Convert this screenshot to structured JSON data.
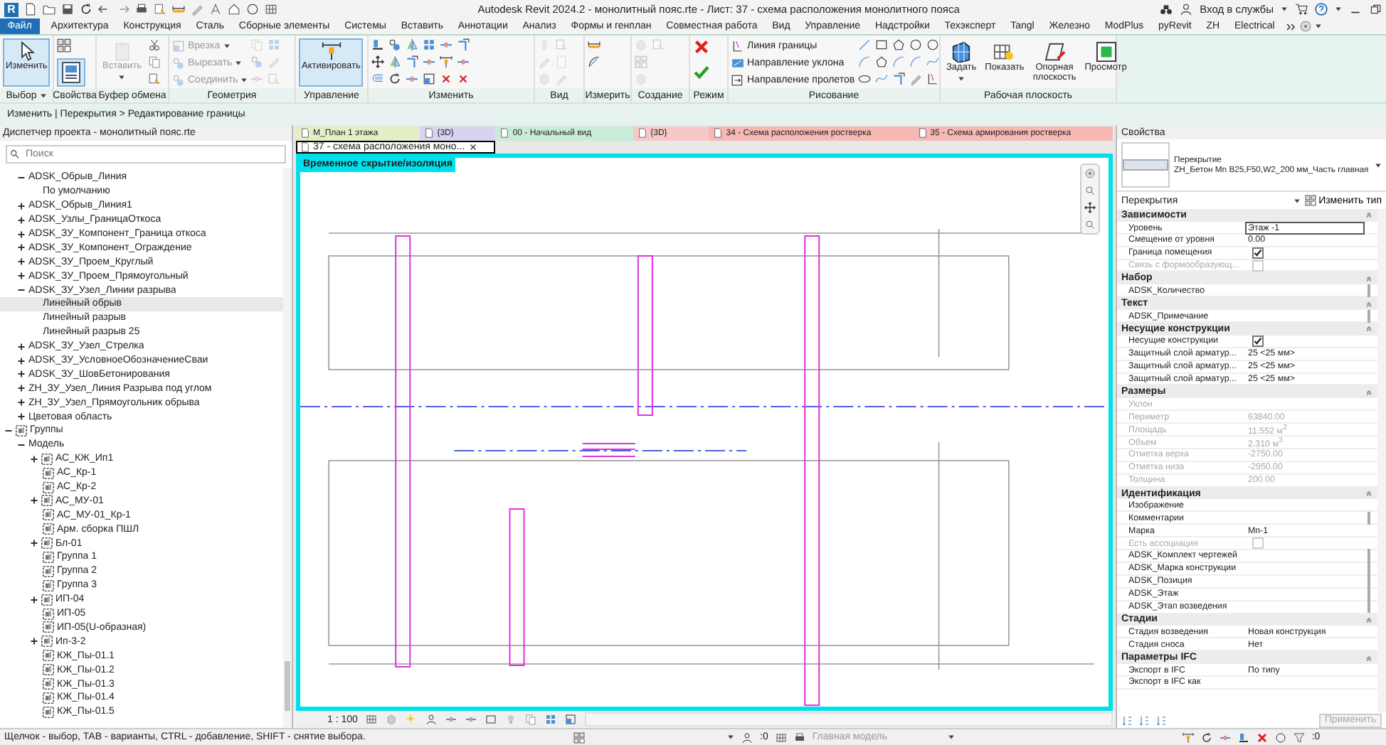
{
  "window": {
    "app_logo": "R",
    "title": "Autodesk Revit 2024.2 - монолитный пояс.rte - Лист: 37 - схема расположения монолитного пояса",
    "sign_in": "Вход в службы"
  },
  "menu_tabs": [
    {
      "label": "Файл",
      "kind": "file",
      "selected": false
    },
    {
      "label": "Архитектура",
      "kind": "tab",
      "selected": false
    },
    {
      "label": "Конструкция",
      "kind": "tab",
      "selected": false
    },
    {
      "label": "Сталь",
      "kind": "tab",
      "selected": false
    },
    {
      "label": "Сборные элементы",
      "kind": "tab",
      "selected": false
    },
    {
      "label": "Системы",
      "kind": "tab",
      "selected": false
    },
    {
      "label": "Вставить",
      "kind": "tab",
      "selected": false
    },
    {
      "label": "Аннотации",
      "kind": "tab",
      "selected": false
    },
    {
      "label": "Анализ",
      "kind": "tab",
      "selected": false
    },
    {
      "label": "Формы и генплан",
      "kind": "tab",
      "selected": false
    },
    {
      "label": "Совместная работа",
      "kind": "tab",
      "selected": false
    },
    {
      "label": "Вид",
      "kind": "tab",
      "selected": false
    },
    {
      "label": "Управление",
      "kind": "tab",
      "selected": false
    },
    {
      "label": "Надстройки",
      "kind": "tab",
      "selected": false
    },
    {
      "label": "Техэксперт",
      "kind": "tab",
      "selected": false
    },
    {
      "label": "Tangl",
      "kind": "tab",
      "selected": false
    },
    {
      "label": "Железно",
      "kind": "tab",
      "selected": false
    },
    {
      "label": "ModPlus",
      "kind": "tab",
      "selected": false
    },
    {
      "label": "pyRevit",
      "kind": "tab",
      "selected": false
    },
    {
      "label": "ZH",
      "kind": "tab",
      "selected": false
    },
    {
      "label": "Electrical",
      "kind": "tab",
      "selected": false
    }
  ],
  "ribbon": {
    "panels": [
      {
        "label": "Выбор",
        "dropdown": true,
        "tools": [
          {
            "label": "Изменить",
            "kind": "large",
            "selected": true,
            "disabled": false
          }
        ]
      },
      {
        "label": "Свойства",
        "tools": [
          {
            "kind": "icon",
            "selected": true,
            "disabled": false
          }
        ]
      },
      {
        "label": "Буфер обмена",
        "tools": [
          {
            "label": "Вставить",
            "kind": "large",
            "selected": false,
            "disabled": true,
            "dropdown": true
          }
        ]
      },
      {
        "label": "Геометрия",
        "icons_disabled": true,
        "tools": [
          {
            "label": "Врезка",
            "kind": "small",
            "selected": false,
            "disabled": true,
            "dropdown": true
          },
          {
            "label": "Вырезать",
            "kind": "small",
            "selected": false,
            "disabled": true,
            "dropdown": true
          },
          {
            "label": "Соединить",
            "kind": "small",
            "selected": false,
            "disabled": true,
            "dropdown": true
          }
        ]
      },
      {
        "label": "Управление",
        "tools": [
          {
            "label": "Активировать",
            "kind": "large",
            "selected": true,
            "disabled": false
          }
        ]
      },
      {
        "label": "Изменить"
      },
      {
        "label": "Вид",
        "icons_disabled": true
      },
      {
        "label": "Измерить"
      },
      {
        "label": "Создание",
        "icons_disabled": true
      },
      {
        "label": "Режим"
      },
      {
        "label": "Рисование",
        "tools": [
          {
            "label": "Линия границы",
            "kind": "small",
            "selected": false,
            "disabled": false
          },
          {
            "label": "Направление уклона",
            "kind": "small",
            "selected": false,
            "disabled": false
          },
          {
            "label": "Направление пролетов",
            "kind": "small",
            "selected": false,
            "disabled": false
          }
        ]
      },
      {
        "label": "Рабочая плоскость",
        "tools": [
          {
            "label": "Задать",
            "kind": "large",
            "selected": false,
            "disabled": false,
            "dropdown": true
          },
          {
            "label": "Показать",
            "kind": "large",
            "selected": false,
            "disabled": false
          },
          {
            "label": "Опорная плоскость",
            "kind": "large",
            "selected": false,
            "disabled": false
          },
          {
            "label": "Просмотр",
            "kind": "large",
            "selected": false,
            "disabled": false
          }
        ]
      }
    ]
  },
  "breadcrumb": "Изменить | Перекрытия > Редактирование границы",
  "browser": {
    "title": "Диспетчер проекта - монолитный пояс.rte",
    "search": {
      "placeholder": "Поиск"
    },
    "tree": [
      {
        "kind": "continuation",
        "children": [
          {
            "label": "ADSK_Обрыв_Линия",
            "expanded": true,
            "selected": false,
            "children": [
              {
                "label": "По умолчанию",
                "selected": false
              }
            ]
          },
          {
            "label": "ADSK_Обрыв_Линия1",
            "expanded": false,
            "selected": false
          },
          {
            "label": "ADSK_Узлы_ГраницаОткоса",
            "expanded": false,
            "selected": false
          },
          {
            "label": "ADSK_ЗУ_Компонент_Граница откоса",
            "expanded": false,
            "selected": false
          },
          {
            "label": "ADSK_ЗУ_Компонент_Ограждение",
            "expanded": false,
            "selected": false
          },
          {
            "label": "ADSK_ЗУ_Проем_Круглый",
            "expanded": false,
            "selected": false
          },
          {
            "label": "ADSK_ЗУ_Проем_Прямоугольный",
            "expanded": false,
            "selected": false
          },
          {
            "label": "ADSK_ЗУ_Узел_Линии разрыва",
            "expanded": true,
            "selected": false,
            "children": [
              {
                "label": "Линейный обрыв",
                "selected": true
              },
              {
                "label": "Линейный разрыв",
                "selected": false
              },
              {
                "label": "Линейный разрыв 25",
                "selected": false
              }
            ]
          },
          {
            "label": "ADSK_ЗУ_Узел_Стрелка",
            "expanded": false,
            "selected": false
          },
          {
            "label": "ADSK_ЗУ_УсловноеОбозначениеСваи",
            "expanded": false,
            "selected": false
          },
          {
            "label": "ADSK_ЗУ_ШовБетонирования",
            "expanded": false,
            "selected": false
          },
          {
            "label": "ZH_ЗУ_Узел_Линия Разрыва под углом",
            "expanded": false,
            "selected": false
          },
          {
            "label": "ZH_ЗУ_Узел_Прямоугольник обрыва",
            "expanded": false,
            "selected": false
          },
          {
            "label": "Цветовая область",
            "expanded": false,
            "selected": false
          }
        ]
      },
      {
        "label": "Группы",
        "kind": "group",
        "expanded": true,
        "selected": false,
        "children": [
          {
            "label": "Модель",
            "expanded": true,
            "selected": false,
            "children": [
              {
                "label": "АС_КЖ_Ип1",
                "kind": "group",
                "expanded": false,
                "selected": false
              },
              {
                "label": "АС_Кр-1",
                "kind": "group",
                "selected": false
              },
              {
                "label": "АС_Кр-2",
                "kind": "group",
                "selected": false
              },
              {
                "label": "АС_МУ-01",
                "kind": "group",
                "expanded": false,
                "selected": false
              },
              {
                "label": "АС_МУ-01_Кр-1",
                "kind": "group",
                "selected": false
              },
              {
                "label": "Арм. сборка ПШЛ",
                "kind": "group",
                "selected": false
              },
              {
                "label": "Бл-01",
                "kind": "group",
                "expanded": false,
                "selected": false
              },
              {
                "label": "Группа 1",
                "kind": "group",
                "selected": false
              },
              {
                "label": "Группа 2",
                "kind": "group",
                "selected": false
              },
              {
                "label": "Группа 3",
                "kind": "group",
                "selected": false
              },
              {
                "label": "ИП-04",
                "kind": "group",
                "expanded": false,
                "selected": false
              },
              {
                "label": "ИП-05",
                "kind": "group",
                "selected": false
              },
              {
                "label": "ИП-05(U-образная)",
                "kind": "group",
                "selected": false
              },
              {
                "label": "Ип-3-2",
                "kind": "group",
                "expanded": false,
                "selected": false
              },
              {
                "label": "КЖ_Пы-01.1",
                "kind": "group",
                "selected": false
              },
              {
                "label": "КЖ_Пы-01.2",
                "kind": "group",
                "selected": false
              },
              {
                "label": "КЖ_Пы-01.3",
                "kind": "group",
                "selected": false
              },
              {
                "label": "КЖ_Пы-01.4",
                "kind": "group",
                "selected": false
              },
              {
                "label": "КЖ_Пы-01.5",
                "kind": "group",
                "selected": false
              }
            ]
          }
        ]
      }
    ]
  },
  "canvas": {
    "doc_tabs": [
      {
        "label": "М_План 1 этажа",
        "selected": false,
        "color": "#e3efc4"
      },
      {
        "label": "{3D}",
        "selected": false,
        "color": "#d9d2f0"
      },
      {
        "label": "00 - Начальный вид",
        "selected": false,
        "color": "#c9ecd6"
      },
      {
        "label": "{3D}",
        "selected": false,
        "color": "#f6c9c6"
      },
      {
        "label": "34 - Схема расположения ростверка",
        "selected": false,
        "color": "#f6b9b4"
      },
      {
        "label": "35 - Схема армирования ростверка",
        "selected": false,
        "color": "#f6b9b4"
      },
      {
        "label": "37 - схема расположения моно...",
        "selected": true,
        "color": "#ffffff"
      }
    ],
    "isolation_label": "Временное скрытие/изоляция",
    "scale": "1 : 100"
  },
  "properties": {
    "title": "Свойства",
    "type_category": "Перекрытие",
    "type_name": "ZH_Бетон Mn B25,F50,W2_200 мм_Часть главная",
    "filter": "Перекрытия",
    "edit_type": "Изменить тип",
    "groups": [
      {
        "name": "Зависимости",
        "rows": [
          {
            "name": "Уровень",
            "value": "Этаж -1",
            "kind": "input"
          },
          {
            "name": "Смещение от уровня",
            "value": "0.00",
            "kind": "text"
          },
          {
            "name": "Граница помещения",
            "kind": "check",
            "checked": true
          },
          {
            "name": "Связь с формообразующ...",
            "kind": "check",
            "checked": false,
            "disabled": true
          }
        ]
      },
      {
        "name": "Набор",
        "rows": [
          {
            "name": "ADSK_Количество",
            "kind": "text",
            "assoc": true
          }
        ]
      },
      {
        "name": "Текст",
        "rows": [
          {
            "name": "ADSK_Примечание",
            "kind": "text",
            "assoc": true
          }
        ]
      },
      {
        "name": "Несущие конструкции",
        "rows": [
          {
            "name": "Несущие конструкции",
            "kind": "check",
            "checked": true
          },
          {
            "name": "Защитный слой арматур...",
            "value": "25 <25 мм>",
            "kind": "text"
          },
          {
            "name": "Защитный слой арматур...",
            "value": "25 <25 мм>",
            "kind": "text"
          },
          {
            "name": "Защитный слой арматур...",
            "value": "25 <25 мм>",
            "kind": "text"
          }
        ]
      },
      {
        "name": "Размеры",
        "rows": [
          {
            "name": "Уклон",
            "kind": "text",
            "disabled": true
          },
          {
            "name": "Периметр",
            "value": "63840.00",
            "kind": "text",
            "disabled": true
          },
          {
            "name": "Площадь",
            "value": "11.552 м$^{2}$",
            "kind": "text",
            "disabled": true
          },
          {
            "name": "Объем",
            "value": "2.310 м$^{3}$",
            "kind": "text",
            "disabled": true
          },
          {
            "name": "Отметка верха",
            "value": "-2750.00",
            "kind": "text",
            "disabled": true
          },
          {
            "name": "Отметка низа",
            "value": "-2950.00",
            "kind": "text",
            "disabled": true
          },
          {
            "name": "Толщина",
            "value": "200.00",
            "kind": "text",
            "disabled": true
          }
        ]
      },
      {
        "name": "Идентификация",
        "rows": [
          {
            "name": "Изображение",
            "kind": "text"
          },
          {
            "name": "Комментарии",
            "kind": "text",
            "assoc": true
          },
          {
            "name": "Марка",
            "value": "Мп-1",
            "kind": "text"
          },
          {
            "name": "Есть ассоциация",
            "kind": "check",
            "checked": false,
            "disabled": true
          },
          {
            "name": "ADSK_Комплект чертежей",
            "kind": "text",
            "assoc": true
          },
          {
            "name": "ADSK_Марка конструкции",
            "kind": "text",
            "assoc": true
          },
          {
            "name": "ADSK_Позиция",
            "kind": "text",
            "assoc": true
          },
          {
            "name": "ADSK_Этаж",
            "kind": "text",
            "assoc": true
          },
          {
            "name": "ADSK_Этап возведения",
            "kind": "text",
            "assoc": true
          }
        ]
      },
      {
        "name": "Стадии",
        "rows": [
          {
            "name": "Стадия возведения",
            "value": "Новая конструкция",
            "kind": "text"
          },
          {
            "name": "Стадия сноса",
            "value": "Нет",
            "kind": "text"
          }
        ]
      },
      {
        "name": "Параметры IFC",
        "rows": [
          {
            "name": "Экспорт в IFC",
            "value": "По типу",
            "kind": "text"
          },
          {
            "name": "Экспорт в IFC как",
            "kind": "text"
          }
        ]
      }
    ],
    "apply": {
      "label": "Применить",
      "disabled": true
    }
  },
  "status_bar": {
    "hint": "Щелчок - выбор, TAB - варианты, CTRL - добавление, SHIFT - снятие выбора.",
    "links_count": ":0",
    "model": "Главная модель",
    "filter_count": ":0"
  }
}
